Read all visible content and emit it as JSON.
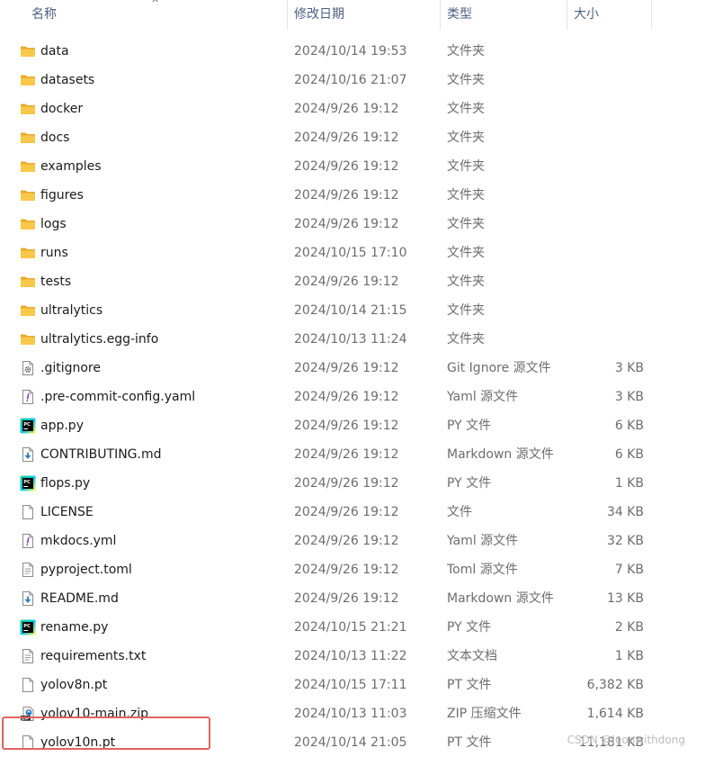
{
  "header": {
    "name": "名称",
    "date": "修改日期",
    "type": "类型",
    "size": "大小",
    "sort_caret": "^"
  },
  "rows": [
    {
      "name": "data",
      "date": "2024/10/14 19:53",
      "type": "文件夹",
      "size": "",
      "icon": "folder-icon"
    },
    {
      "name": "datasets",
      "date": "2024/10/16 21:07",
      "type": "文件夹",
      "size": "",
      "icon": "folder-icon"
    },
    {
      "name": "docker",
      "date": "2024/9/26 19:12",
      "type": "文件夹",
      "size": "",
      "icon": "folder-icon"
    },
    {
      "name": "docs",
      "date": "2024/9/26 19:12",
      "type": "文件夹",
      "size": "",
      "icon": "folder-icon"
    },
    {
      "name": "examples",
      "date": "2024/9/26 19:12",
      "type": "文件夹",
      "size": "",
      "icon": "folder-icon"
    },
    {
      "name": "figures",
      "date": "2024/9/26 19:12",
      "type": "文件夹",
      "size": "",
      "icon": "folder-icon"
    },
    {
      "name": "logs",
      "date": "2024/9/26 19:12",
      "type": "文件夹",
      "size": "",
      "icon": "folder-icon"
    },
    {
      "name": "runs",
      "date": "2024/10/15 17:10",
      "type": "文件夹",
      "size": "",
      "icon": "folder-icon"
    },
    {
      "name": "tests",
      "date": "2024/9/26 19:12",
      "type": "文件夹",
      "size": "",
      "icon": "folder-icon"
    },
    {
      "name": "ultralytics",
      "date": "2024/10/14 21:15",
      "type": "文件夹",
      "size": "",
      "icon": "folder-icon"
    },
    {
      "name": "ultralytics.egg-info",
      "date": "2024/10/13 11:24",
      "type": "文件夹",
      "size": "",
      "icon": "folder-icon"
    },
    {
      "name": ".gitignore",
      "date": "2024/9/26 19:12",
      "type": "Git Ignore 源文件",
      "size": "3 KB",
      "icon": "gear-file-icon"
    },
    {
      "name": ".pre-commit-config.yaml",
      "date": "2024/9/26 19:12",
      "type": "Yaml 源文件",
      "size": "3 KB",
      "icon": "yaml-file-icon"
    },
    {
      "name": "app.py",
      "date": "2024/9/26 19:12",
      "type": "PY 文件",
      "size": "6 KB",
      "icon": "pycharm-icon"
    },
    {
      "name": "CONTRIBUTING.md",
      "date": "2024/9/26 19:12",
      "type": "Markdown 源文件",
      "size": "6 KB",
      "icon": "markdown-file-icon"
    },
    {
      "name": "flops.py",
      "date": "2024/9/26 19:12",
      "type": "PY 文件",
      "size": "1 KB",
      "icon": "pycharm-icon"
    },
    {
      "name": "LICENSE",
      "date": "2024/9/26 19:12",
      "type": "文件",
      "size": "34 KB",
      "icon": "blank-file-icon"
    },
    {
      "name": "mkdocs.yml",
      "date": "2024/9/26 19:12",
      "type": "Yaml 源文件",
      "size": "32 KB",
      "icon": "yaml-file-icon"
    },
    {
      "name": "pyproject.toml",
      "date": "2024/9/26 19:12",
      "type": "Toml 源文件",
      "size": "7 KB",
      "icon": "text-file-icon"
    },
    {
      "name": "README.md",
      "date": "2024/9/26 19:12",
      "type": "Markdown 源文件",
      "size": "13 KB",
      "icon": "markdown-file-icon"
    },
    {
      "name": "rename.py",
      "date": "2024/10/15 21:21",
      "type": "PY 文件",
      "size": "2 KB",
      "icon": "pycharm-icon"
    },
    {
      "name": "requirements.txt",
      "date": "2024/10/13 11:22",
      "type": "文本文档",
      "size": "1 KB",
      "icon": "text-file-icon"
    },
    {
      "name": "yolov8n.pt",
      "date": "2024/10/15 17:11",
      "type": "PT 文件",
      "size": "6,382 KB",
      "icon": "blank-file-icon"
    },
    {
      "name": "yolov10-main.zip",
      "date": "2024/10/13 11:03",
      "type": "ZIP 压缩文件",
      "size": "1,614 KB",
      "icon": "zip-file-icon"
    },
    {
      "name": "yolov10n.pt",
      "date": "2024/10/14 21:05",
      "type": "PT 文件",
      "size": "11,181 KB",
      "icon": "blank-file-icon"
    }
  ],
  "watermark": "CSDN @leonwithdong"
}
